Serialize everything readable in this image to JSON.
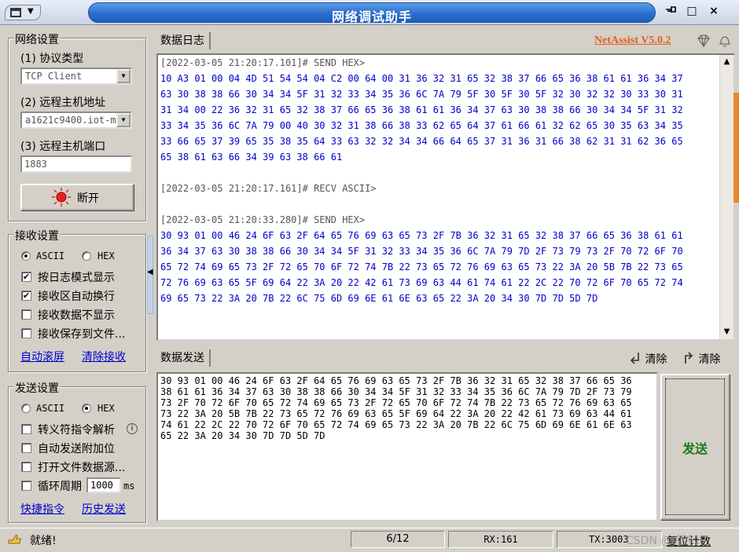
{
  "window": {
    "title": "网络调试助手",
    "sys_menu_arrow": "▼",
    "min_label": "–",
    "max_label": "□",
    "close_label": "×"
  },
  "net_settings": {
    "title": "网络设置",
    "protocol_label": "(1) 协议类型",
    "protocol_value": "TCP Client",
    "host_label": "(2) 远程主机地址",
    "host_value": "a1621c9400.iot-m",
    "port_label": "(3) 远程主机端口",
    "port_value": "1883",
    "disconnect_label": "断开"
  },
  "recv_settings": {
    "title": "接收设置",
    "ascii_label": "ASCII",
    "hex_label": "HEX",
    "selected": "ASCII",
    "log_mode_label": "按日志模式显示",
    "log_mode_checked": true,
    "auto_wrap_label": "接收区自动换行",
    "auto_wrap_checked": true,
    "hide_data_label": "接收数据不显示",
    "hide_data_checked": false,
    "save_file_label": "接收保存到文件...",
    "save_file_checked": false,
    "auto_scroll_link": "自动滚屏",
    "clear_recv_link": "清除接收"
  },
  "send_settings": {
    "title": "发送设置",
    "ascii_label": "ASCII",
    "hex_label": "HEX",
    "selected": "HEX",
    "escape_label": "转义符指令解析",
    "escape_info": "i",
    "escape_checked": false,
    "append_label": "自动发送附加位",
    "append_checked": false,
    "file_source_label": "打开文件数据源...",
    "file_source_checked": false,
    "loop_label": "循环周期",
    "loop_value": "1000",
    "loop_unit": "ms",
    "loop_checked": false,
    "quick_cmd_link": "快捷指令",
    "history_link": "历史发送"
  },
  "log_panel": {
    "tab": "数据日志",
    "brand": "NetAssist V5.0.2",
    "entries": [
      {
        "head": "[2022-03-05 21:20:17.101]# SEND HEX>",
        "lines": [
          "10 A3 01 00 04 4D 51 54 54 04 C2 00 64 00 31 36 32 31 65 32 38 37 66 65 36 38 61 61 36 34 37",
          "63 30 38 38 66 30 34 34 5F 31 32 33 34 35 36 6C 7A 79 5F 30 5F 30 5F 32 30 32 32 30 33 30 31",
          "31 34 00 22 36 32 31 65 32 38 37 66 65 36 38 61 61 36 34 37 63 30 38 38 66 30 34 34 5F 31 32",
          "33 34 35 36 6C 7A 79 00 40 30 32 31 38 66 38 33 62 65 64 37 61 66 61 32 62 65 30 35 63 34 35",
          "33 66 65 37 39 65 35 38 35 64 33 63 32 32 34 34 66 64 65 37 31 36 31 66 38 62 31 31 62 36 65",
          "65 38 61 63 66 34 39 63 38 66 61"
        ]
      },
      {
        "head": "[2022-03-05 21:20:17.161]# RECV ASCII>",
        "lines": []
      },
      {
        "head": "[2022-03-05 21:20:33.280]# SEND HEX>",
        "lines": [
          "30 93 01 00 46 24 6F 63 2F 64 65 76 69 63 65 73 2F 7B 36 32 31 65 32 38 37 66 65 36 38 61 61",
          "36 34 37 63 30 38 38 66 30 34 34 5F 31 32 33 34 35 36 6C 7A 79 7D 2F 73 79 73 2F 70 72 6F 70",
          "65 72 74 69 65 73 2F 72 65 70 6F 72 74 7B 22 73 65 72 76 69 63 65 73 22 3A 20 5B 7B 22 73 65",
          "72 76 69 63 65 5F 69 64 22 3A 20 22 42 61 73 69 63 44 61 74 61 22 2C 22 70 72 6F 70 65 72 74",
          "69 65 73 22 3A 20 7B 22 6C 75 6D 69 6E 61 6E 63 65 22 3A 20 34 30 7D 7D 5D 7D"
        ]
      }
    ]
  },
  "send_panel": {
    "tab": "数据发送",
    "clear_label_1": "清除",
    "clear_label_2": "清除",
    "lines": [
      "30 93 01 00 46 24 6F 63 2F 64 65 76 69 63 65 73 2F 7B 36 32 31 65 32 38 37 66 65 36",
      "38 61 61 36 34 37 63 30 38 38 66 30 34 34 5F 31 32 33 34 35 36 6C 7A 79 7D 2F 73 79",
      "73 2F 70 72 6F 70 65 72 74 69 65 73 2F 72 65 70 6F 72 74 7B 22 73 65 72 76 69 63 65",
      "73 22 3A 20 5B 7B 22 73 65 72 76 69 63 65 5F 69 64 22 3A 20 22 42 61 73 69 63 44 61",
      "74 61 22 2C 22 70 72 6F 70 65 72 74 69 65 73 22 3A 20 7B 22 6C 75 6D 69 6E 61 6E 63",
      "65 22 3A 20 34 30 7D 7D 5D 7D"
    ],
    "send_label": "发送"
  },
  "status": {
    "ready": "就绪!",
    "page": "6/12",
    "rx": "RX:161",
    "tx": "TX:3003",
    "reset": "复位计数",
    "watermark": "CSDN @惊鸿1"
  }
}
